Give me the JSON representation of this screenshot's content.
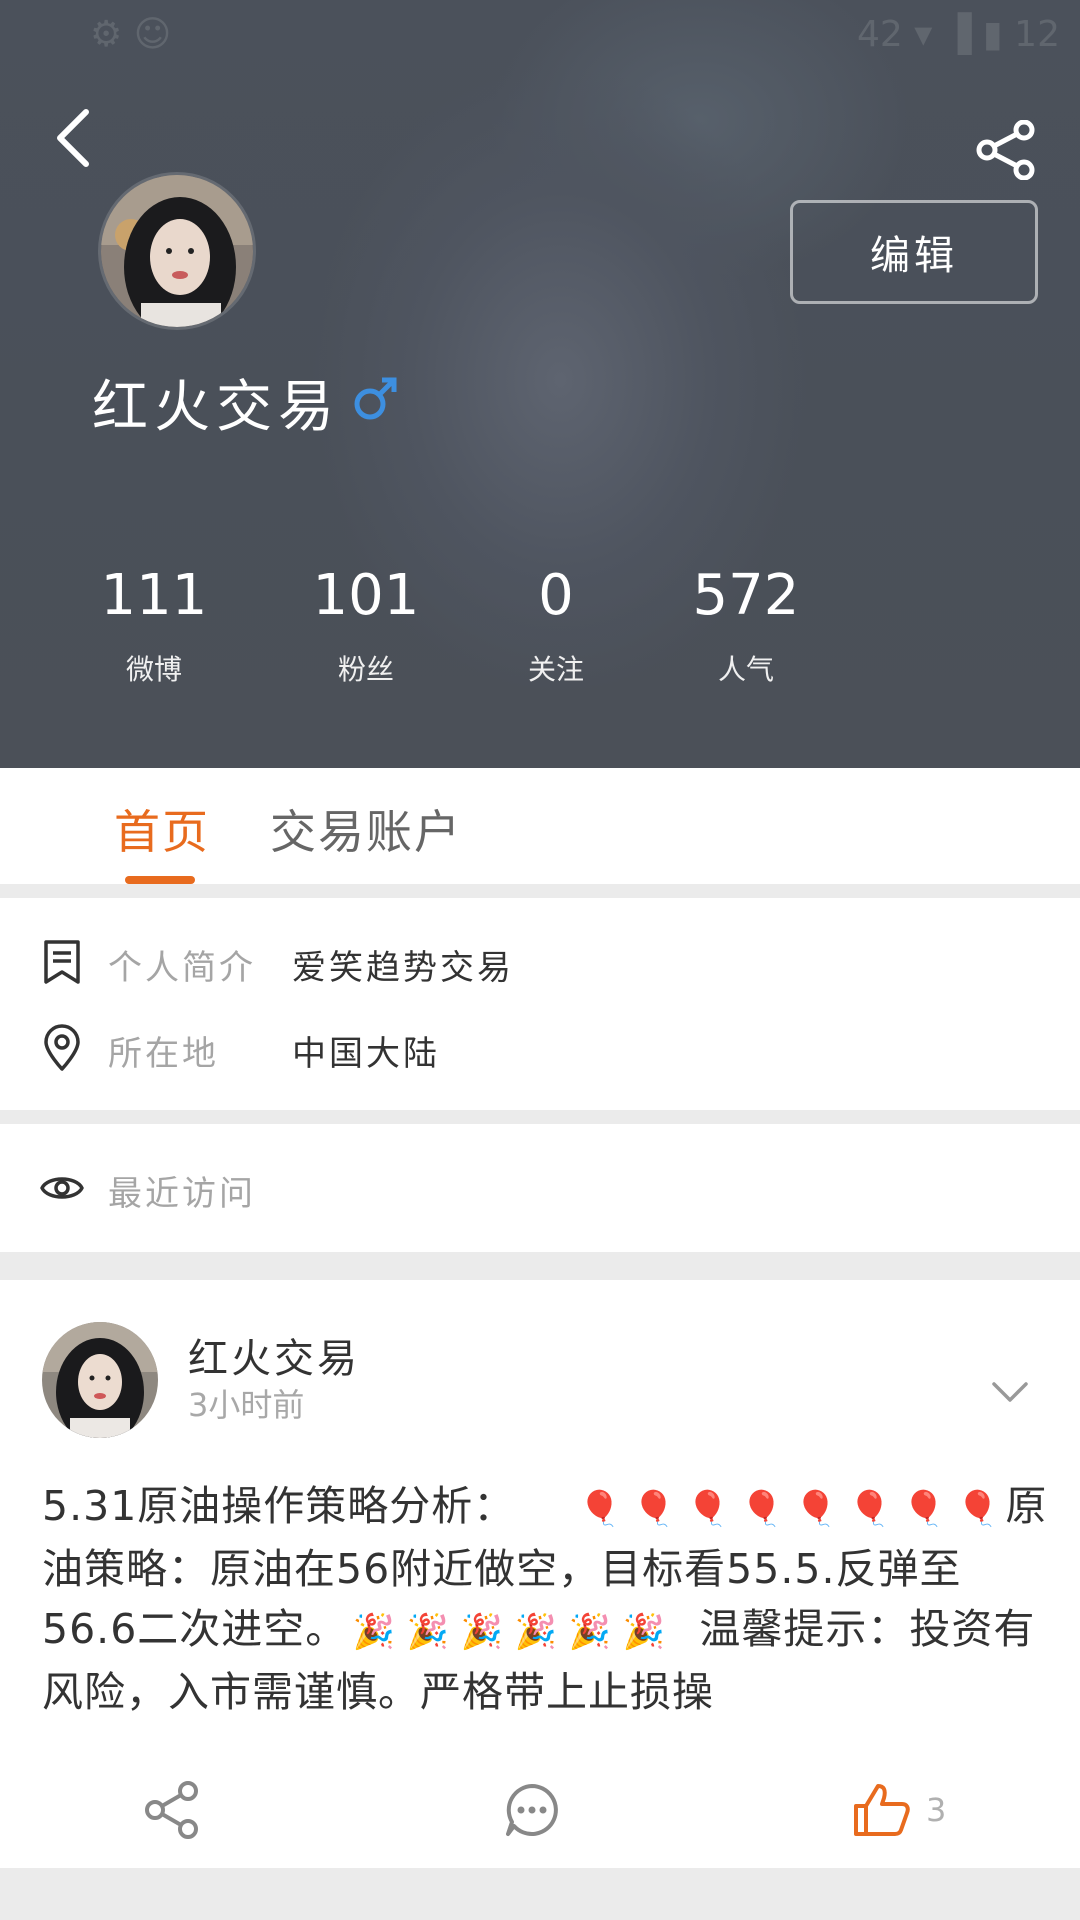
{
  "status_bar": {
    "left_text": "⚙ ☺",
    "right_text": "42 ▾ ▐ ▮ 12"
  },
  "profile": {
    "name": "红火交易",
    "gender_symbol": "♂",
    "gender_color": "#3d8fe0",
    "edit_label": "编辑",
    "stats": [
      {
        "value": "111",
        "label": "微博"
      },
      {
        "value": "101",
        "label": "粉丝"
      },
      {
        "value": "0",
        "label": "关注"
      },
      {
        "value": "572",
        "label": "人气"
      }
    ]
  },
  "tabs": [
    {
      "label": "首页",
      "active": true
    },
    {
      "label": "交易账户",
      "active": false
    }
  ],
  "info": {
    "bio_label": "个人简介",
    "bio_value": "爱笑趋势交易",
    "location_label": "所在地",
    "location_value": "中国大陆"
  },
  "recent_visits": {
    "label": "最近访问"
  },
  "post": {
    "author": "红火交易",
    "time": "3小时前",
    "text_1": "5.31原油操作策略分析：",
    "text_2": "原油策略：原油在56附近做空，目标看55.5.反弹至56.6二次进空。",
    "text_3": "温馨提示：投资有风险，入市需谨慎。严格带上止损操",
    "balloon_emoji": "🎈",
    "party_emoji": "🎉",
    "like_count": "3"
  },
  "colors": {
    "accent": "#e86b1e",
    "header_bg": "#4b515b"
  }
}
